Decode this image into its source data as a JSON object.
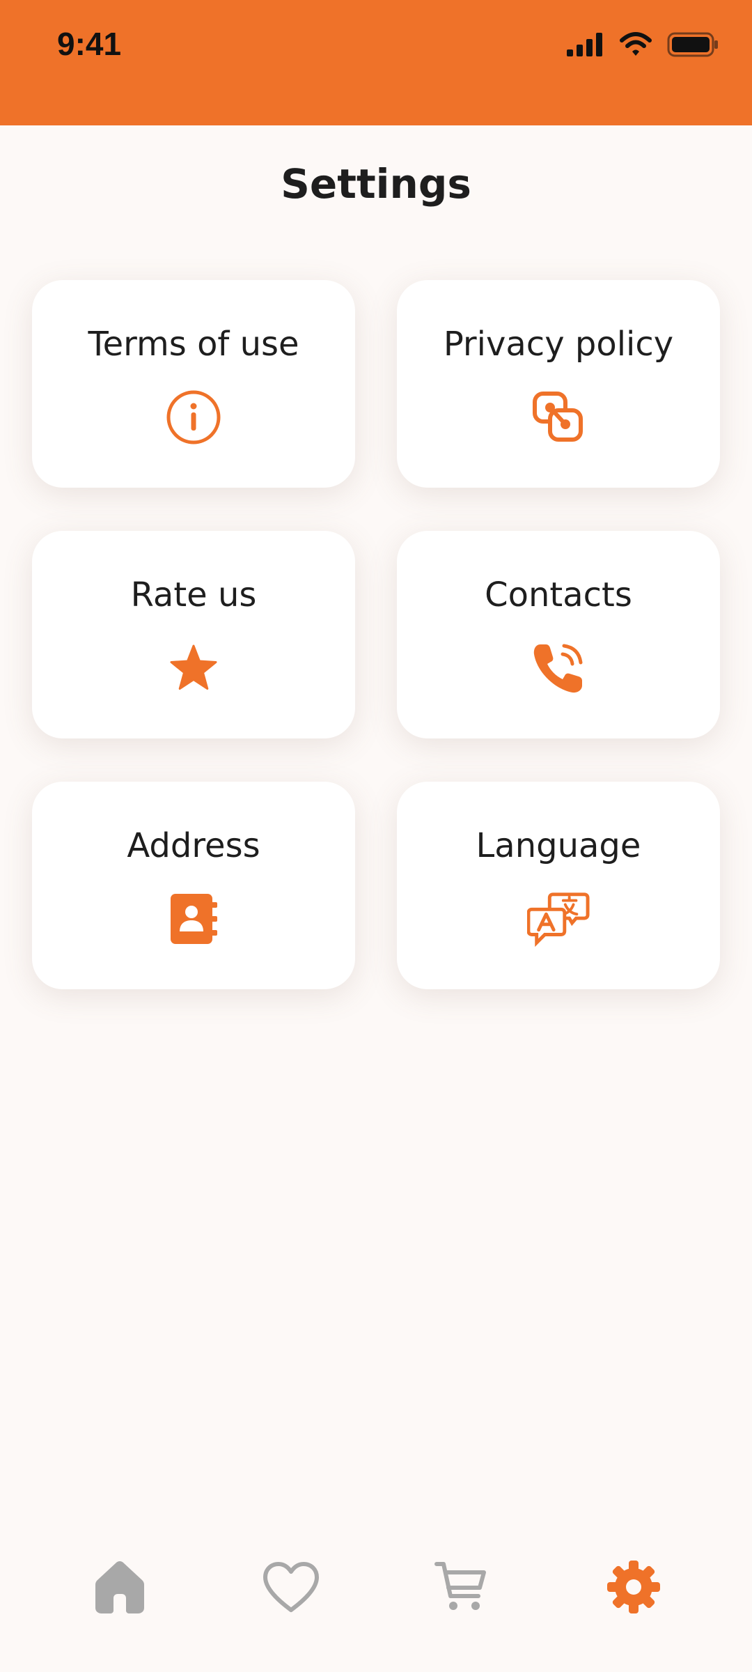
{
  "status_bar": {
    "time": "9:41",
    "icons": [
      "signal-icon",
      "wifi-icon",
      "battery-icon"
    ],
    "background": "#EF7229"
  },
  "page": {
    "title": "Settings"
  },
  "colors": {
    "accent": "#EF7229",
    "inactive": "#A8A8A8",
    "background": "#FDF9F7"
  },
  "cards": [
    {
      "label": "Terms of use",
      "icon": "info-circle-icon"
    },
    {
      "label": "Privacy policy",
      "icon": "privacy-link-icon"
    },
    {
      "label": "Rate us",
      "icon": "star-icon"
    },
    {
      "label": "Contacts",
      "icon": "phone-ringing-icon"
    },
    {
      "label": "Address",
      "icon": "address-book-icon"
    },
    {
      "label": "Language",
      "icon": "translate-icon"
    }
  ],
  "bottom_nav": [
    {
      "icon": "home-icon",
      "active": false
    },
    {
      "icon": "heart-icon",
      "active": false
    },
    {
      "icon": "cart-icon",
      "active": false
    },
    {
      "icon": "gear-icon",
      "active": true
    }
  ]
}
